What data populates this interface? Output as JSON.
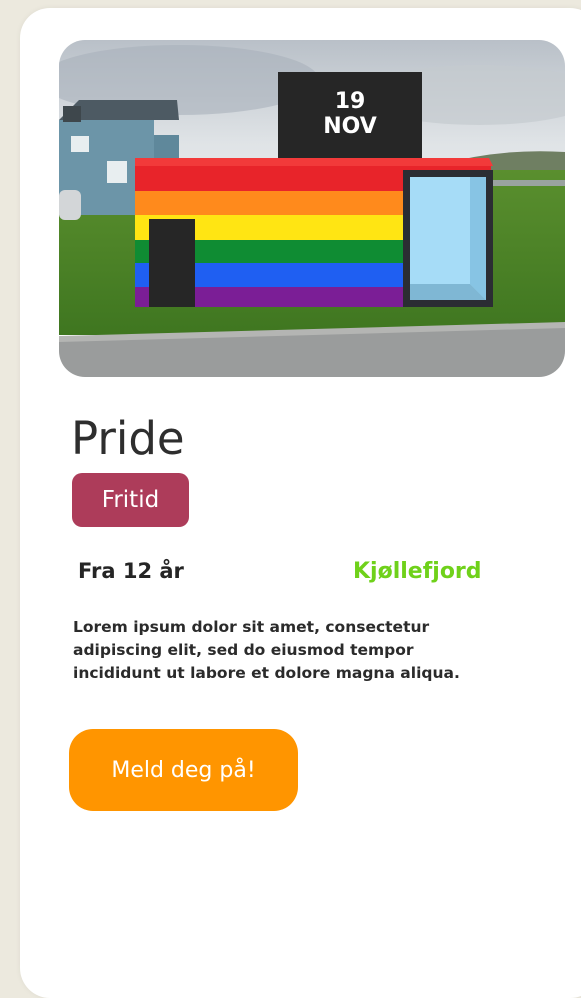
{
  "event": {
    "date": {
      "day": "19",
      "month": "NOV"
    },
    "title": "Pride",
    "category": "Fritid",
    "age": "Fra 12 år",
    "location": "Kjøllefjord",
    "description": "Lorem ipsum dolor sit amet, consectetur adipiscing elit, sed do eiusmod tempor incididunt ut labore et dolore magna aliqua.",
    "signup_label": "Meld deg på!"
  },
  "colors": {
    "background": "#ece9de",
    "card": "#ffffff",
    "date_badge": "#262626",
    "category_badge": "#ad3c5a",
    "location_text": "#6fd11a",
    "signup_button": "#ff9500",
    "rainbow": [
      "#e8242a",
      "#ff8a1c",
      "#ffe513",
      "#0f8c33",
      "#1f5ff2",
      "#7b1e96"
    ]
  }
}
